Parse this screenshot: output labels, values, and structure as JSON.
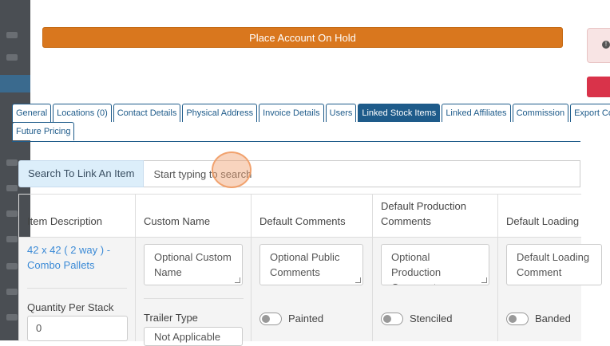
{
  "hold_button": "Place Account On Hold",
  "tabs": [
    "General",
    "Locations (0)",
    "Contact Details",
    "Physical Address",
    "Invoice Details",
    "Users",
    "Linked Stock Items",
    "Linked Affiliates",
    "Commission",
    "Export Con"
  ],
  "tabs_row2": [
    "Future Pricing"
  ],
  "active_tab": "Linked Stock Items",
  "search": {
    "label": "Search To Link An Item",
    "placeholder": "Start typing to search"
  },
  "table": {
    "headers": [
      "Item Description",
      "Custom Name",
      "Default Comments",
      "Default Production Comments",
      "Default Loading"
    ],
    "row": {
      "item_description": "42 x 42 ( 2 way ) - Combo Pallets",
      "quantity_label": "Quantity Per Stack",
      "quantity_value": "0",
      "custom_name_placeholder": "Optional Custom Name",
      "trailer_type_label": "Trailer Type",
      "trailer_type_value": "Not Applicable",
      "comments_placeholder": "Optional Public Comments",
      "production_placeholder": "Optional Production Comments",
      "loading_placeholder": "Default Loading Comment",
      "toggles": [
        "Painted",
        "Stenciled",
        "Banded"
      ]
    }
  },
  "colors": {
    "accent": "#1e5b8a",
    "hold": "#d9771e",
    "danger": "#d9334a",
    "link": "#3b8ad6"
  }
}
